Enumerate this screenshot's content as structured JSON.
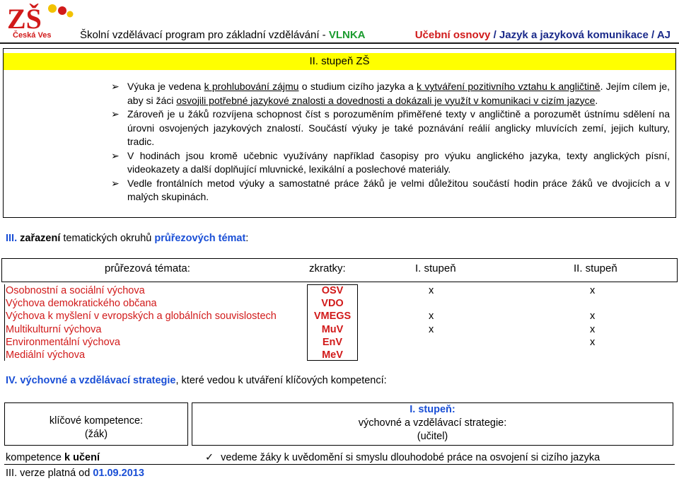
{
  "logo": {
    "text_big": "ZŠ",
    "text_small": "Česká Ves",
    "colors": {
      "red": "#d11a1a",
      "blue": "#1a4fd6",
      "yellow": "#f2c200"
    }
  },
  "header": {
    "left_prefix": "Školní vzdělávací program pro základní vzdělávání - ",
    "left_brand": "VLNKA",
    "right_osnovy": "Učební osnovy",
    "right_rest": " / Jazyk a jazyková komunikace / AJ"
  },
  "stage": {
    "label": "II. stupeň ZŠ"
  },
  "bullets": [
    [
      "Výuka je vedena ",
      "k prohlubování zájmu",
      " o studium cizího jazyka a ",
      "k vytváření pozitivního vztahu k angličtině",
      ". ",
      "Jejím cílem je, aby si žáci",
      " ",
      "osvojili potřebné jazykové znalosti a dovednosti a dokázali je využít v komunikaci v cizím jazyce",
      "."
    ],
    [
      "Zároveň je u žáků rozvíjena schopnost číst s porozuměním přiměřené texty v angličtině a porozumět ústnímu sdělení na úrovni osvojených jazykových znalostí. Součástí výuky je také poznávání reálií anglicky mluvících zemí, jejich kultury, tradic."
    ],
    [
      "V hodinách jsou kromě učebnic využívány například časopisy pro výuku anglického jazyka, texty anglických písní, videokazety a další doplňující mluvnické, lexikální a poslechové materiály."
    ],
    [
      "Vedle frontálních metod výuky a samostatné práce žáků je velmi důležitou součástí hodin práce žáků ve dvojicích a v malých skupinách."
    ]
  ],
  "section3": {
    "num": "III.",
    "bold": " zařazení",
    "mid": " tematických okruhů ",
    "blue": "průřezových témat",
    "end": ":"
  },
  "table1": {
    "headers": [
      "průřezová témata:",
      "zkratky:",
      "I. stupeň",
      "II. stupeň"
    ],
    "rows": [
      {
        "name": "Osobnostní a sociální výchova",
        "abbr": "OSV",
        "s1": "x",
        "s2": "x"
      },
      {
        "name": "Výchova demokratického občana",
        "abbr": "VDO",
        "s1": "",
        "s2": ""
      },
      {
        "name": "Výchova k myšlení v evropských a globálních souvislostech",
        "abbr": "VMEGS",
        "s1": "x",
        "s2": "x"
      },
      {
        "name": "Multikulturní výchova",
        "abbr": "MuV",
        "s1": "x",
        "s2": "x"
      },
      {
        "name": "Environmentální výchova",
        "abbr": "EnV",
        "s1": "",
        "s2": "x"
      },
      {
        "name": "Mediální výchova",
        "abbr": "MeV",
        "s1": "",
        "s2": ""
      }
    ]
  },
  "section4": {
    "num": "IV.",
    "blue": " výchovné a vzdělávací strategie",
    "rest": ", které vedou k utváření klíčových kompetencí:"
  },
  "table2": {
    "left_line1": "klíčové kompetence:",
    "left_line2": "(žák)",
    "right_stage": "I. stupeň:",
    "right_line1": "výchovné a vzdělávací strategie:",
    "right_line2": "(učitel)",
    "row_left_prefix": "kompetence ",
    "row_left_bold": "k učení",
    "row_right": "vedeme žáky k uvědomění si smyslu dlouhodobé práce na osvojení si cizího jazyka",
    "check": "✓"
  },
  "footer": {
    "prefix": "III. verze platná od ",
    "date": "01.09.2013"
  }
}
